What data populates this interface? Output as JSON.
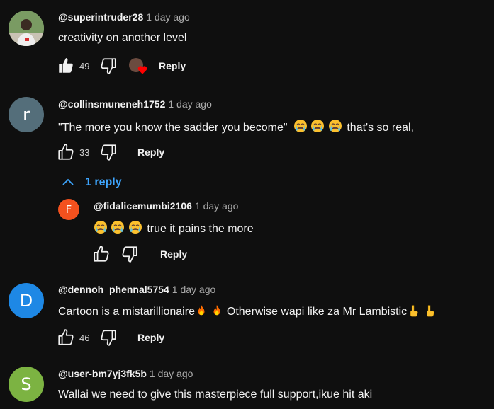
{
  "comments": [
    {
      "author": "@superintruder28",
      "time": "1 day ago",
      "text": "creativity on another level",
      "likes": "49",
      "reply_label": "Reply",
      "creator_heart": true
    },
    {
      "author": "@collinsmuneneh1752",
      "time": "1 day ago",
      "text_before": "\"The more you know the sadder you become\"",
      "emoji": "crying-face",
      "text_after": "that's so real,",
      "likes": "33",
      "reply_label": "Reply",
      "avatar_letter": "r",
      "avatar_color": "#546e7a",
      "replies_toggle": "1 reply",
      "reply": {
        "author": "@fidalicemumbi2106",
        "time": "1 day ago",
        "text": "true it pains the more",
        "reply_label": "Reply",
        "avatar_letter": "F",
        "avatar_color": "#f4511e"
      }
    },
    {
      "author": "@dennoh_phennal5754",
      "time": "1 day ago",
      "text_before": "Cartoon is a mistarillionaire",
      "emoji_1": "fire",
      "text_after": "Otherwise wapi like za Mr Lambistic",
      "emoji_2": "pointing-down-hand",
      "likes": "46",
      "reply_label": "Reply",
      "avatar_letter": "D",
      "avatar_color": "#1e88e5"
    },
    {
      "author": "@user-bm7yj3fk5b",
      "time": "1 day ago",
      "text": "Wallai we need to give this masterpiece full support,ikue hit aki",
      "avatar_letter": "S",
      "avatar_color": "#7cb342"
    }
  ]
}
